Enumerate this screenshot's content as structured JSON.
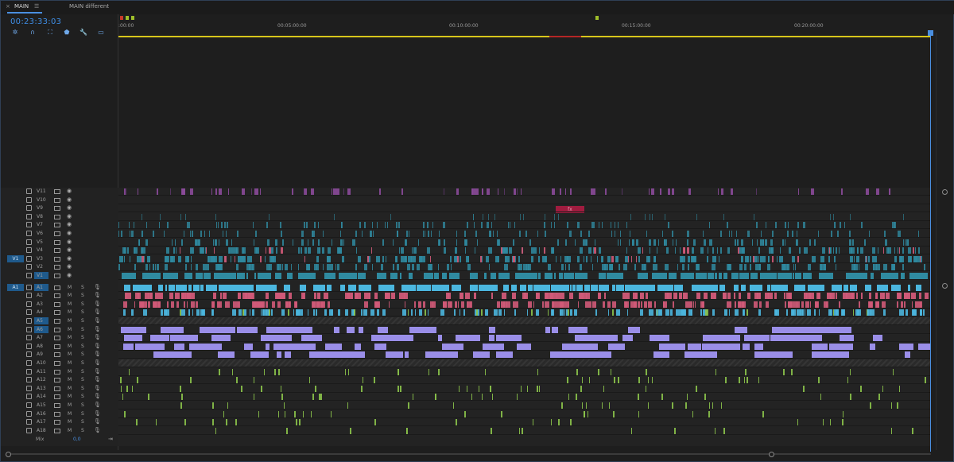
{
  "tabs": {
    "active": {
      "close": "×",
      "label": "MAIN",
      "menu": "☰"
    },
    "other": {
      "label": "MAIN different"
    }
  },
  "timecode": "00:23:33:03",
  "tools": [
    {
      "name": "snap-icon",
      "glyph": "✲"
    },
    {
      "name": "magnet-icon",
      "glyph": "∩"
    },
    {
      "name": "linked-selection-icon",
      "glyph": "⛶"
    },
    {
      "name": "marker-icon",
      "glyph": "⬟"
    },
    {
      "name": "wrench-icon",
      "glyph": "🔧"
    },
    {
      "name": "captions-icon",
      "glyph": "▭"
    }
  ],
  "ruler": {
    "labels": [
      ":00:00",
      "00:05:00:00",
      "00:10:00:00",
      "00:15:00:00",
      "00:20:00:00"
    ]
  },
  "colors": {
    "accent": "#4a8fe0",
    "video_purple": "#8b4a9a",
    "video_teal": "#2f8aa0",
    "audio_cyan": "#4bb6de",
    "audio_pink": "#d05a78",
    "audio_lavender": "#9a8ee8",
    "audio_green": "#8bc34a",
    "ruler_yellow": "#d8c61a",
    "fx_red": "#a01c3f"
  },
  "fx_clip": {
    "label": "fx"
  },
  "video_tracks": [
    {
      "name": "V11",
      "source": ""
    },
    {
      "name": "V10",
      "source": ""
    },
    {
      "name": "V9",
      "source": ""
    },
    {
      "name": "V8",
      "source": ""
    },
    {
      "name": "V7",
      "source": ""
    },
    {
      "name": "V6",
      "source": ""
    },
    {
      "name": "V5",
      "source": ""
    },
    {
      "name": "V4",
      "source": ""
    },
    {
      "name": "V3",
      "source": "V1"
    },
    {
      "name": "V2",
      "source": ""
    },
    {
      "name": "V1",
      "source": ""
    }
  ],
  "audio_tracks": [
    {
      "name": "A1",
      "source": "A1",
      "m": "M",
      "s": "S"
    },
    {
      "name": "A2",
      "source": "",
      "m": "M",
      "s": "S"
    },
    {
      "name": "A3",
      "source": "",
      "m": "M",
      "s": "S"
    },
    {
      "name": "A4",
      "source": "",
      "m": "M",
      "s": "S"
    },
    {
      "name": "A5",
      "source": "",
      "m": "M",
      "s": "S"
    },
    {
      "name": "A6",
      "source": "",
      "m": "M",
      "s": "S"
    },
    {
      "name": "A7",
      "source": "",
      "m": "M",
      "s": "S"
    },
    {
      "name": "A8",
      "source": "",
      "m": "M",
      "s": "S"
    },
    {
      "name": "A9",
      "source": "",
      "m": "M",
      "s": "S"
    },
    {
      "name": "A10",
      "source": "",
      "m": "M",
      "s": "S"
    },
    {
      "name": "A11",
      "source": "",
      "m": "M",
      "s": "S"
    },
    {
      "name": "A12",
      "source": "",
      "m": "M",
      "s": "S"
    },
    {
      "name": "A13",
      "source": "",
      "m": "M",
      "s": "S"
    },
    {
      "name": "A14",
      "source": "",
      "m": "M",
      "s": "S"
    },
    {
      "name": "A15",
      "source": "",
      "m": "M",
      "s": "S"
    },
    {
      "name": "A16",
      "source": "",
      "m": "M",
      "s": "S"
    },
    {
      "name": "A17",
      "source": "",
      "m": "M",
      "s": "S"
    },
    {
      "name": "A18",
      "source": "",
      "m": "M",
      "s": "S"
    }
  ],
  "mix": {
    "label": "Mix",
    "value": "0,0"
  }
}
